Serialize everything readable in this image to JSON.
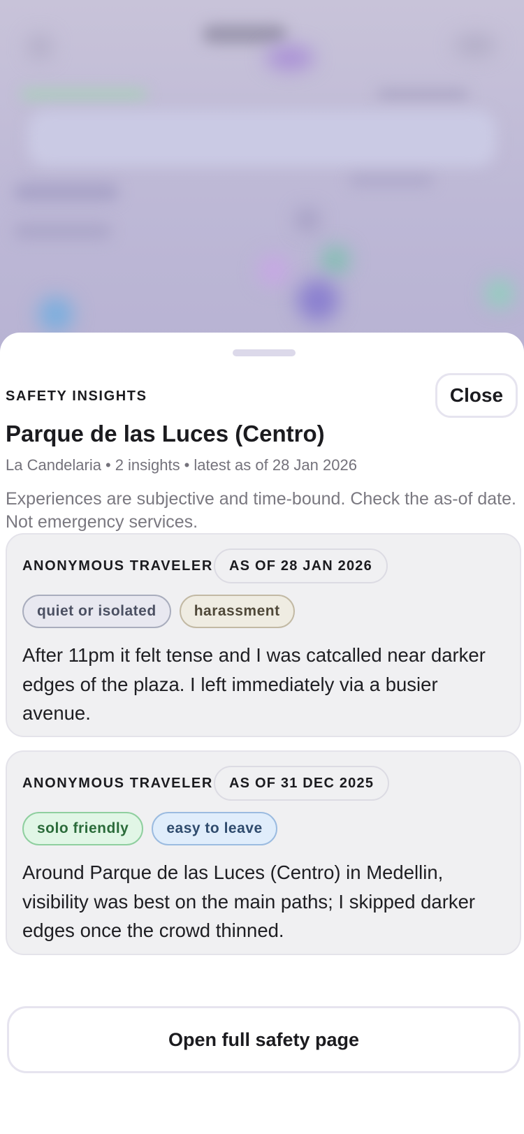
{
  "sheet": {
    "eyebrow": "SAFETY INSIGHTS",
    "close_label": "Close",
    "place_title": "Parque de las Luces (Centro)",
    "meta": {
      "neighborhood": "La Candelaria",
      "insights_count": "2 insights",
      "latest": "latest as of 28 Jan 2026",
      "separator": "•"
    },
    "disclaimer": "Experiences are subjective and time-bound. Check the as-of date. Not emergency services.",
    "insights": [
      {
        "author": "ANONYMOUS TRAVELER",
        "date": "AS OF 28 JAN 2026",
        "tags": [
          {
            "label": "quiet or isolated",
            "style": "gray"
          },
          {
            "label": "harassment",
            "style": "beige"
          }
        ],
        "text": "After 11pm it felt tense and I was catcalled near darker edges of the plaza. I left immediately via a busier avenue."
      },
      {
        "author": "ANONYMOUS TRAVELER",
        "date": "AS OF 31 DEC 2025",
        "tags": [
          {
            "label": "solo friendly",
            "style": "green"
          },
          {
            "label": "easy to leave",
            "style": "blue"
          }
        ],
        "text": "Around Parque de las Luces (Centro) in Medellin, visibility was best on the main paths; I skipped darker edges once the crowd thinned."
      }
    ],
    "open_full_label": "Open full safety page"
  },
  "colors": {
    "background_overlay": "#c4bfd8",
    "sheet": "#ffffff",
    "card": "#f0f0f2",
    "text_primary": "#1b1b1f",
    "text_secondary": "#74727b"
  }
}
